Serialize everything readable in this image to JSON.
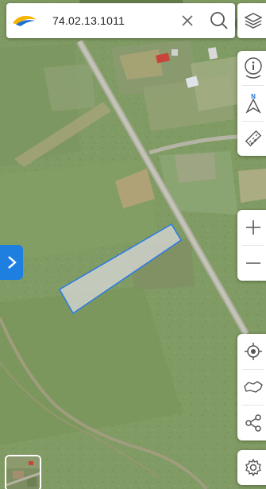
{
  "search": {
    "value": "74.02.13.1011"
  },
  "icons": {
    "logo": "brand-logo-icon",
    "clear": "close-icon",
    "search": "search-icon",
    "layers": "layers-icon",
    "info": "info-icon",
    "compass": "compass-north-icon",
    "measure": "ruler-icon",
    "zoom_in": "plus-icon",
    "zoom_out": "minus-icon",
    "locate": "my-location-icon",
    "region": "region-outline-icon",
    "share": "share-icon",
    "settings": "gear-icon",
    "expand": "chevron-right-icon",
    "basemap": "basemap-thumbnail"
  },
  "compass_label": "N",
  "colors": {
    "parcel_outline": "#2a7be4",
    "parcel_fill": "#d9d9d9",
    "accent": "#1e7fe0",
    "logo_yellow": "#f6b400",
    "logo_blue": "#1f6fd6"
  }
}
